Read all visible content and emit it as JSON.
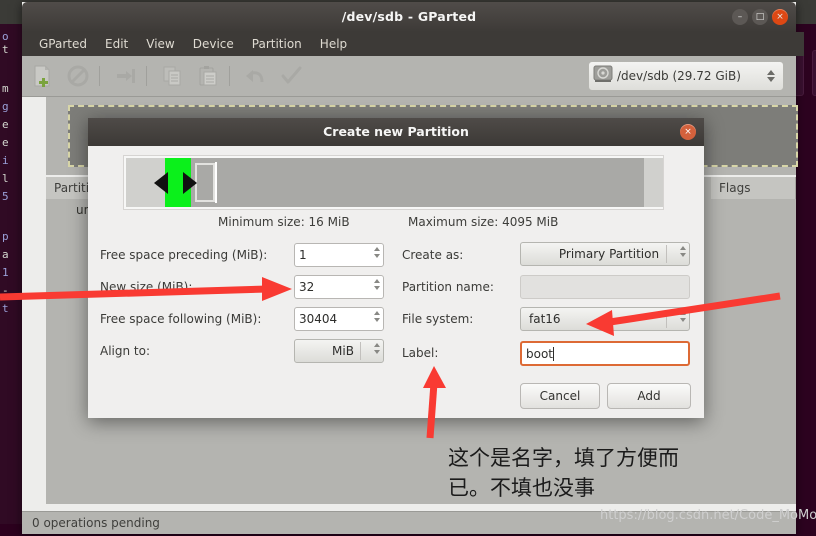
{
  "window": {
    "title": "/dev/sdb - GParted",
    "controls": {
      "minimize": "–",
      "maximize": "□",
      "close": "×"
    }
  },
  "menubar": {
    "items": [
      {
        "label": "GParted"
      },
      {
        "label": "Edit"
      },
      {
        "label": "View"
      },
      {
        "label": "Device"
      },
      {
        "label": "Partition"
      },
      {
        "label": "Help"
      }
    ]
  },
  "toolbar": {
    "buttons": [
      {
        "name": "new-partition-icon",
        "title": "New"
      },
      {
        "name": "delete-partition-icon",
        "title": "Delete"
      },
      {
        "name": "resize-move-icon",
        "title": "Resize/Move"
      },
      {
        "name": "copy-icon",
        "title": "Copy"
      },
      {
        "name": "paste-icon",
        "title": "Paste"
      },
      {
        "name": "undo-icon",
        "title": "Undo"
      },
      {
        "name": "apply-icon",
        "title": "Apply"
      }
    ],
    "device_selector": {
      "label": "/dev/sdb  (29.72 GiB)",
      "icon": "hard-disk-icon"
    }
  },
  "partition_table": {
    "columns": [
      "Partition",
      "Flags"
    ],
    "rows": [
      {
        "partition": "unallocated"
      }
    ]
  },
  "statusbar": {
    "text": "0 operations pending"
  },
  "dialog": {
    "title": "Create new Partition",
    "close_label": "×",
    "min_size": "Minimum size: 16 MiB",
    "max_size": "Maximum size: 4095 MiB",
    "fields": {
      "free_preceding_label": "Free space preceding (MiB):",
      "free_preceding_value": "1",
      "new_size_label": "New size (MiB):",
      "new_size_value": "32",
      "free_following_label": "Free space following (MiB):",
      "free_following_value": "30404",
      "align_to_label": "Align to:",
      "align_to_value": "MiB",
      "create_as_label": "Create as:",
      "create_as_value": "Primary Partition",
      "partition_name_label": "Partition name:",
      "partition_name_value": "",
      "partition_name_placeholder": "",
      "file_system_label": "File system:",
      "file_system_value": "fat16",
      "label_label": "Label:",
      "label_value": "boot"
    },
    "buttons": {
      "cancel": "Cancel",
      "add": "Add"
    }
  },
  "annotations": {
    "chinese_note_line1": "这个是名字，填了方便而",
    "chinese_note_line2": "已。不填也没事",
    "watermark": "https://blog.csdn.net/Code_MoMo",
    "arrow_color": "#f93a32"
  },
  "background": {
    "terminal_chars": [
      "o",
      "t",
      "",
      "m",
      "g",
      "e",
      "e",
      "i",
      "l",
      "5",
      "",
      "p",
      "a",
      "1",
      "-",
      "t"
    ],
    "dash_search_icon": "search-icon"
  },
  "colors": {
    "titlebar": "#443f3c",
    "toolbar": "#b4b4b0",
    "dialog_bg": "#f0efee",
    "accent_orange": "#dd4814",
    "partition_green": "#0bf01b",
    "arrow_red": "#f93a32"
  }
}
